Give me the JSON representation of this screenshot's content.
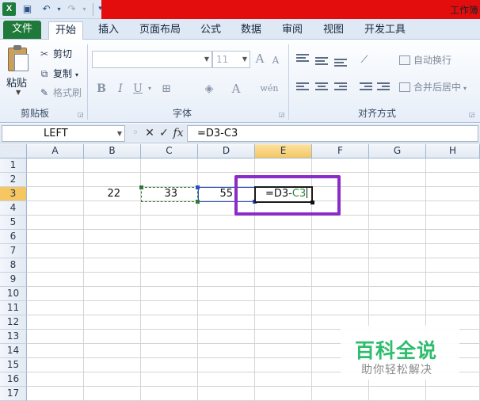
{
  "app": {
    "window_title": "工作簿",
    "quick_access": {
      "save_icon": "save-icon",
      "undo_icon": "undo-icon",
      "redo_icon": "redo-icon",
      "customize_icon": "customize-icon"
    }
  },
  "tabs": [
    "文件",
    "开始",
    "插入",
    "页面布局",
    "公式",
    "数据",
    "审阅",
    "视图",
    "开发工具"
  ],
  "active_tab": "开始",
  "ribbon": {
    "clipboard": {
      "paste": "粘贴",
      "cut": "剪切",
      "copy": "复制",
      "format_painter": "格式刷",
      "label": "剪贴板"
    },
    "font": {
      "font_name": "",
      "font_size": "11",
      "grow": "A",
      "shrink": "A",
      "bold": "B",
      "italic": "I",
      "underline": "U",
      "label": "字体"
    },
    "alignment": {
      "wrap_text": "自动换行",
      "merge_center": "合并后居中",
      "label": "对齐方式"
    }
  },
  "formula_bar": {
    "name_box": "LEFT",
    "cancel": "✕",
    "enter": "✓",
    "fx": "fx",
    "formula": "=D3-C3"
  },
  "columns": [
    "A",
    "B",
    "C",
    "D",
    "E",
    "F",
    "G",
    "H"
  ],
  "selected_column": "E",
  "rows": [
    "1",
    "2",
    "3",
    "4",
    "5",
    "6",
    "7",
    "8",
    "9",
    "10",
    "11",
    "12",
    "13",
    "14",
    "15",
    "16",
    "17"
  ],
  "selected_row": "3",
  "cells": {
    "B3": "22",
    "C3": "33",
    "D3": "55"
  },
  "editing_cell": {
    "prefix": "=D3-",
    "ref": "C3"
  },
  "watermark": {
    "title": "百科全说",
    "subtitle": "助你轻松解决"
  },
  "colors": {
    "highlight": "#8a2cc6",
    "title_bar": "#e30d0d",
    "file_tab": "#1f7a3a",
    "c_ref": "#2e8b3c",
    "d_ref": "#2a4fc0"
  }
}
